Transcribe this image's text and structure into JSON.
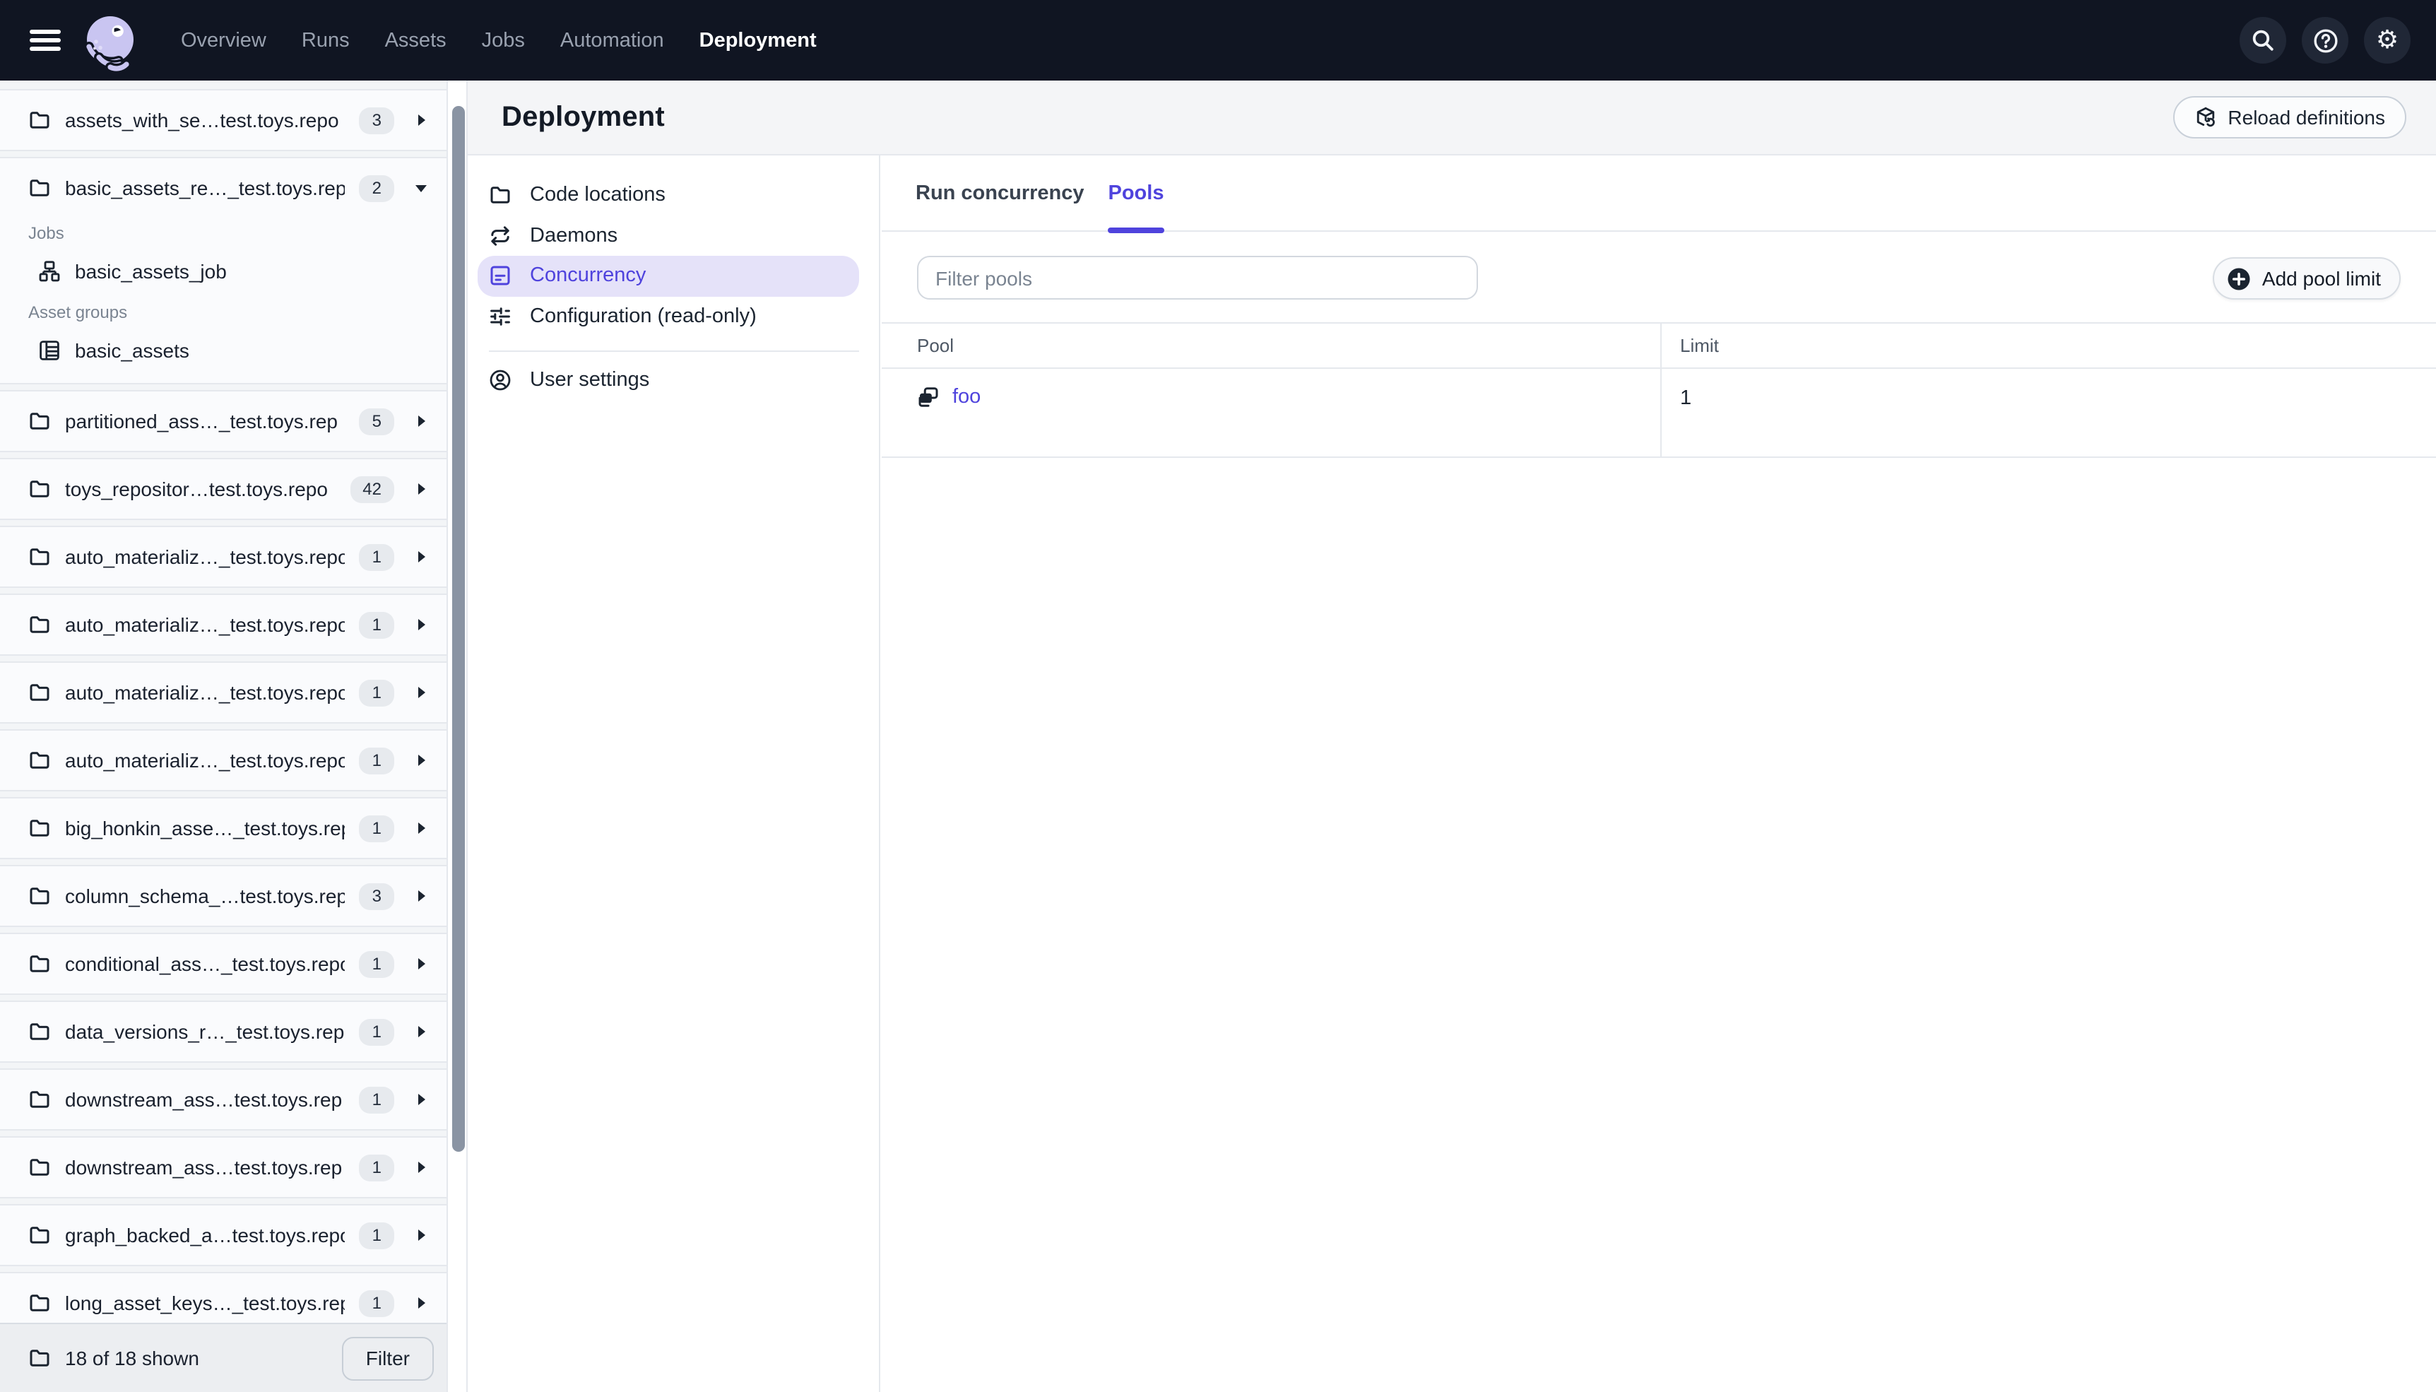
{
  "topnav": {
    "links": [
      {
        "label": "Overview"
      },
      {
        "label": "Runs"
      },
      {
        "label": "Assets"
      },
      {
        "label": "Jobs"
      },
      {
        "label": "Automation"
      },
      {
        "label": "Deployment"
      }
    ],
    "active": "Deployment",
    "actions": [
      {
        "icon": "search-icon"
      },
      {
        "icon": "help-icon"
      },
      {
        "icon": "settings-gear-icon"
      }
    ]
  },
  "sidebar": {
    "repos": [
      {
        "name": "assets_with_se…test.toys.repo",
        "count": "3",
        "expanded": false
      },
      {
        "name": "basic_assets_re…_test.toys.rep",
        "count": "2",
        "expanded": true
      },
      {
        "name": "partitioned_ass…_test.toys.rep",
        "count": "5",
        "expanded": false
      },
      {
        "name": "toys_repositor…test.toys.repo",
        "count": "42",
        "expanded": false
      },
      {
        "name": "auto_materializ…_test.toys.repo",
        "count": "1",
        "expanded": false
      },
      {
        "name": "auto_materializ…_test.toys.repo",
        "count": "1",
        "expanded": false
      },
      {
        "name": "auto_materializ…_test.toys.repo",
        "count": "1",
        "expanded": false
      },
      {
        "name": "auto_materializ…_test.toys.repo",
        "count": "1",
        "expanded": false
      },
      {
        "name": "big_honkin_asse…_test.toys.rep",
        "count": "1",
        "expanded": false
      },
      {
        "name": "column_schema_…test.toys.rep",
        "count": "3",
        "expanded": false
      },
      {
        "name": "conditional_ass…_test.toys.repo",
        "count": "1",
        "expanded": false
      },
      {
        "name": "data_versions_r…_test.toys.rep",
        "count": "1",
        "expanded": false
      },
      {
        "name": "downstream_ass…test.toys.rep",
        "count": "1",
        "expanded": false
      },
      {
        "name": "downstream_ass…test.toys.rep",
        "count": "1",
        "expanded": false
      },
      {
        "name": "graph_backed_a…test.toys.repo",
        "count": "1",
        "expanded": false
      },
      {
        "name": "long_asset_keys…_test.toys.rep",
        "count": "1",
        "expanded": false
      }
    ],
    "expanded_sections": {
      "jobs_label": "Jobs",
      "jobs": [
        "basic_assets_job"
      ],
      "groups_label": "Asset groups",
      "groups": [
        "basic_assets"
      ]
    },
    "footer": {
      "summary": "18 of 18 shown",
      "filter_label": "Filter"
    }
  },
  "page": {
    "title": "Deployment",
    "reload_label": "Reload definitions"
  },
  "settings_nav": {
    "items": [
      {
        "label": "Code locations",
        "icon": "folder-icon",
        "selected": false
      },
      {
        "label": "Daemons",
        "icon": "daemons-icon",
        "selected": false
      },
      {
        "label": "Concurrency",
        "icon": "concurrency-icon",
        "selected": true
      },
      {
        "label": "Configuration (read-only)",
        "icon": "sliders-icon",
        "selected": false
      }
    ],
    "user_settings": {
      "label": "User settings",
      "icon": "user-icon"
    }
  },
  "concurrency_page": {
    "tabs": [
      "Run concurrency",
      "Pools"
    ],
    "active_tab": "Pools",
    "filter_placeholder": "Filter pools",
    "add_button_label": "Add pool limit",
    "table": {
      "columns": [
        "Pool",
        "Limit"
      ],
      "rows": [
        {
          "pool": "foo",
          "limit": "1"
        }
      ]
    }
  },
  "colors": {
    "accent": "#4F43DD",
    "nav_bg": "#101522",
    "scrollbar": "#8A94A3"
  }
}
